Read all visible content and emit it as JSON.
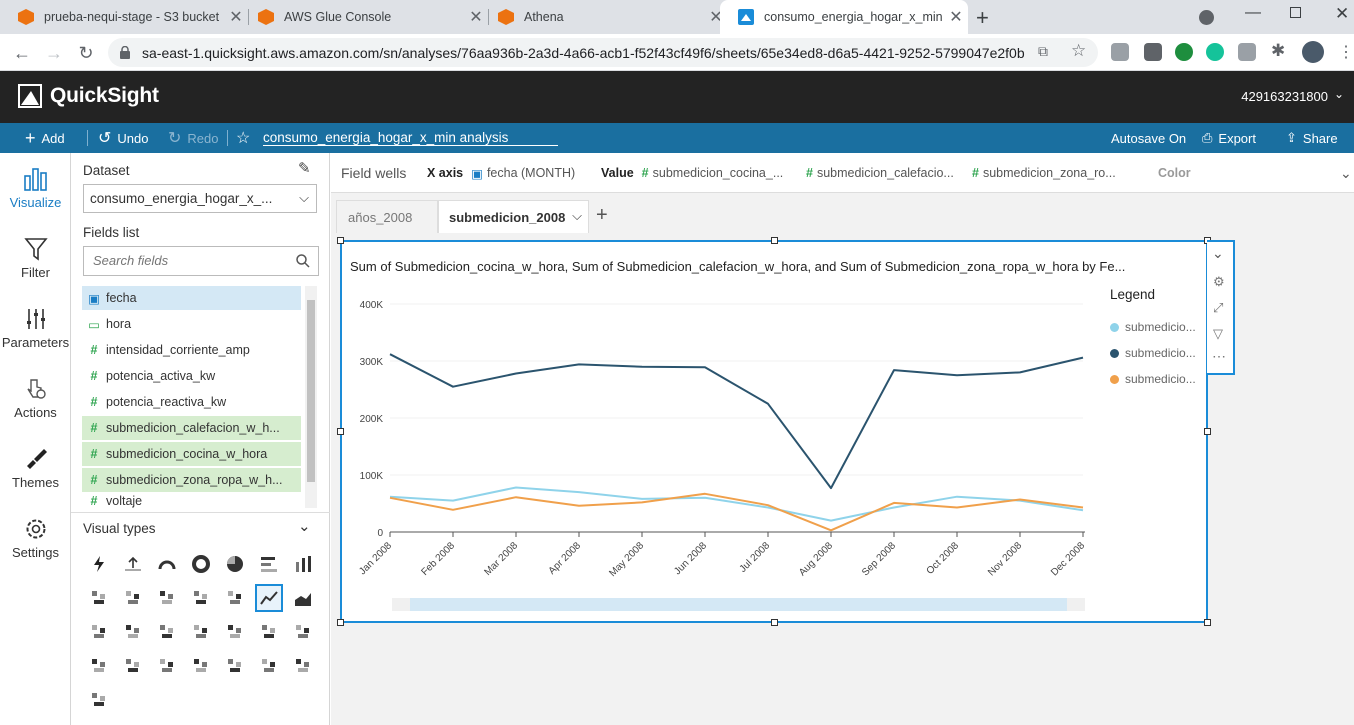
{
  "browser": {
    "tabs": [
      {
        "title": "prueba-nequi-stage - S3 bucket",
        "icon": "aws-s3-icon"
      },
      {
        "title": "AWS Glue Console",
        "icon": "aws-glue-icon"
      },
      {
        "title": "Athena",
        "icon": "aws-athena-icon"
      },
      {
        "title": "consumo_energia_hogar_x_min a",
        "icon": "quicksight-icon"
      }
    ],
    "url": "sa-east-1.quicksight.aws.amazon.com/sn/analyses/76aa936b-2a3d-4a66-acb1-f52f43cf49f6/sheets/65e34ed8-d6a5-4421-9252-5799047e2f0b"
  },
  "header": {
    "brand": "QuickSight",
    "account": "429163231800"
  },
  "toolbar": {
    "add": "Add",
    "undo": "Undo",
    "redo": "Redo",
    "analysis_name": "consumo_energia_hogar_x_min analysis",
    "autosave": "Autosave On",
    "export": "Export",
    "share": "Share"
  },
  "leftnav": {
    "visualize": "Visualize",
    "filter": "Filter",
    "parameters": "Parameters",
    "actions": "Actions",
    "themes": "Themes",
    "settings": "Settings"
  },
  "panel": {
    "dataset_label": "Dataset",
    "dataset_value": "consumo_energia_hogar_x_...",
    "fields_label": "Fields list",
    "search_placeholder": "Search fields",
    "fields": [
      {
        "name": "fecha",
        "type": "date"
      },
      {
        "name": "hora",
        "type": "string"
      },
      {
        "name": "intensidad_corriente_amp",
        "type": "number"
      },
      {
        "name": "potencia_activa_kw",
        "type": "number"
      },
      {
        "name": "potencia_reactiva_kw",
        "type": "number"
      },
      {
        "name": "submedicion_calefacion_w_h...",
        "type": "number"
      },
      {
        "name": "submedicion_cocina_w_hora",
        "type": "number"
      },
      {
        "name": "submedicion_zona_ropa_w_h...",
        "type": "number"
      },
      {
        "name": "voltaje",
        "type": "number"
      }
    ],
    "visual_types_label": "Visual types"
  },
  "wells": {
    "label": "Field wells",
    "xaxis_label": "X axis",
    "xaxis_value": "fecha (MONTH)",
    "value_label": "Value",
    "values": [
      "submedicion_cocina_...",
      "submedicion_calefacio...",
      "submedicion_zona_ro..."
    ],
    "color_label": "Color"
  },
  "sheets": {
    "tabs": [
      "años_2008",
      "submedicion_2008"
    ]
  },
  "colors": {
    "accent": "#1a8cd8",
    "toolbar": "#1a6fa0",
    "header": "#232323",
    "field_highlight": "#d6edcf",
    "field_selected": "#d4e8f5"
  },
  "chart_data": {
    "type": "line",
    "title": "Sum of Submedicion_cocina_w_hora, Sum of Submedicion_calefacion_w_hora, and Sum of Submedicion_zona_ropa_w_hora by Fe...",
    "legend_title": "Legend",
    "categories": [
      "Jan 2008",
      "Feb 2008",
      "Mar 2008",
      "Apr 2008",
      "May 2008",
      "Jun 2008",
      "Jul 2008",
      "Aug 2008",
      "Sep 2008",
      "Oct 2008",
      "Nov 2008",
      "Dec 2008"
    ],
    "yticks": [
      "0",
      "100K",
      "200K",
      "300K",
      "400K"
    ],
    "ylim": [
      0,
      400000
    ],
    "series": [
      {
        "name": "submedicio...",
        "color": "#8fd3ea",
        "values": [
          62000,
          55000,
          78000,
          70000,
          58000,
          60000,
          43000,
          20000,
          43000,
          62000,
          55000,
          38000
        ]
      },
      {
        "name": "submedicio...",
        "color": "#2b546e",
        "values": [
          312000,
          255000,
          278000,
          294000,
          290000,
          289000,
          225000,
          77000,
          284000,
          275000,
          280000,
          306000
        ]
      },
      {
        "name": "submedicio...",
        "color": "#f0a04b",
        "values": [
          60000,
          39000,
          61000,
          46000,
          52000,
          67000,
          47000,
          3000,
          51000,
          43000,
          57000,
          43000
        ]
      }
    ]
  }
}
